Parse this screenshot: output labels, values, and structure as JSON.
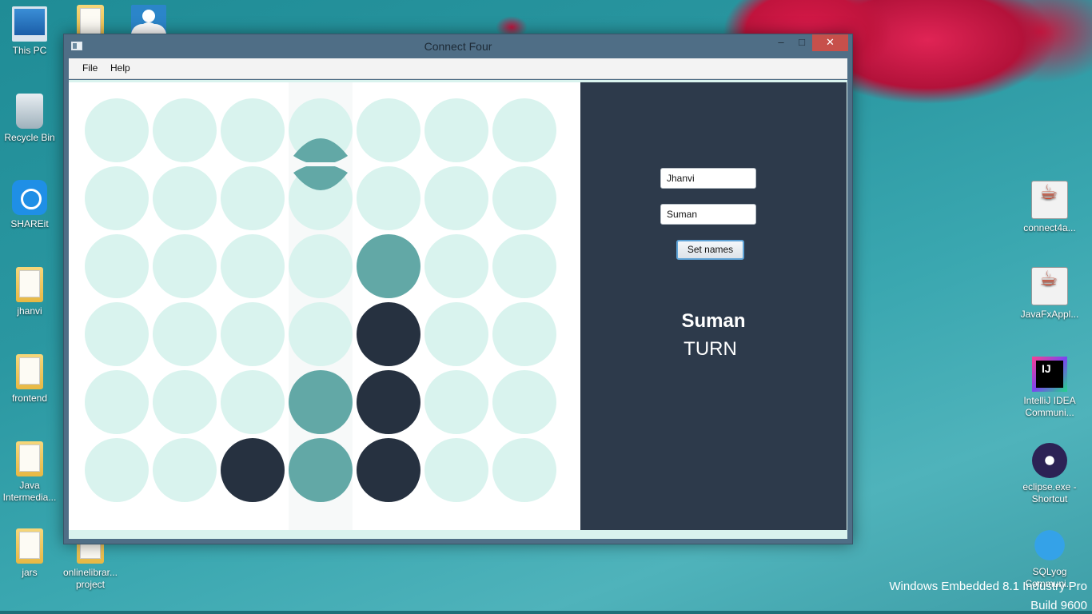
{
  "desktop": {
    "left_icons": [
      {
        "label": "This PC",
        "icon": "computer-icon"
      },
      {
        "label": "Recycle Bin",
        "icon": "recycle-bin-icon"
      },
      {
        "label": "SHAREit",
        "icon": "shareit-icon"
      },
      {
        "label": "jhanvi",
        "icon": "folder-icon"
      },
      {
        "label": "frontend",
        "icon": "folder-icon"
      },
      {
        "label": "Java Intermedia...",
        "icon": "folder-icon"
      },
      {
        "label": "jars",
        "icon": "folder-icon"
      },
      {
        "label": "onlinelibrar... project",
        "icon": "folder-icon"
      }
    ],
    "right_icons": [
      {
        "label": "connect4a...",
        "icon": "java-file-icon"
      },
      {
        "label": "JavaFxAppl...",
        "icon": "java-file-icon"
      },
      {
        "label": "IntelliJ IDEA Communi...",
        "icon": "intellij-icon"
      },
      {
        "label": "eclipse.exe - Shortcut",
        "icon": "eclipse-icon"
      },
      {
        "label": "SQLyog Communi...",
        "icon": "sqlyog-icon"
      }
    ],
    "watermark": {
      "line1": "Windows Embedded 8.1 Industry Pro",
      "line2": "Build 9600"
    }
  },
  "window": {
    "title": "Connect Four",
    "controls": {
      "minimize": "–",
      "maximize": "□",
      "close": "✕"
    },
    "menu": [
      "File",
      "Help"
    ]
  },
  "game": {
    "columns": 7,
    "rows": 6,
    "board": [
      [
        0,
        0,
        0,
        0,
        0,
        0,
        0
      ],
      [
        0,
        0,
        0,
        0,
        0,
        0,
        0
      ],
      [
        0,
        0,
        0,
        0,
        1,
        0,
        0
      ],
      [
        0,
        0,
        0,
        0,
        2,
        0,
        0
      ],
      [
        0,
        0,
        0,
        1,
        2,
        0,
        0
      ],
      [
        0,
        0,
        2,
        1,
        2,
        0,
        0
      ]
    ],
    "hover_column": 3,
    "player1_color": "#62a8a6",
    "player2_color": "#263140",
    "empty_color": "#d9f3ee"
  },
  "panel": {
    "player_one_name": "Jhanvi",
    "player_two_name": "Suman",
    "set_names_label": "Set names",
    "current_player": "Suman",
    "turn_label": "TURN"
  }
}
